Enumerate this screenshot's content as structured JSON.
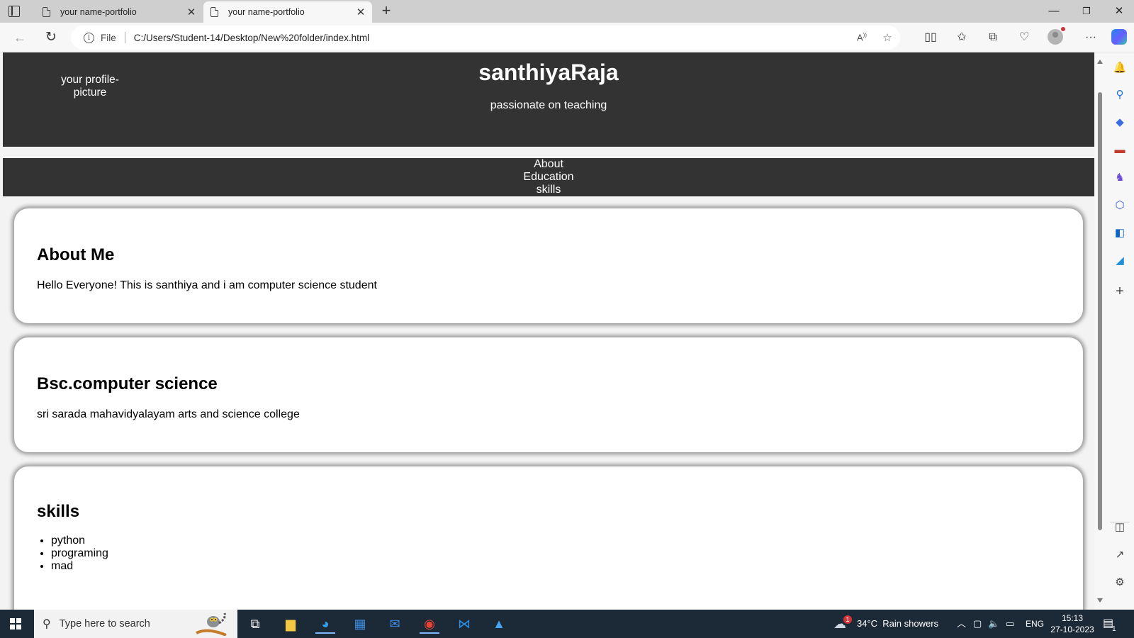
{
  "browser": {
    "tabs": [
      {
        "title": "your name-portfolio",
        "active": false
      },
      {
        "title": "your name-portfolio",
        "active": true
      }
    ],
    "new_tab_icon": "plus-icon",
    "url_scheme_label": "File",
    "url": "C:/Users/Student-14/Desktop/New%20folder/index.html"
  },
  "site": {
    "profile_picture_alt": "your profile-picture",
    "name": "santhiyaRaja",
    "tagline": "passionate on teaching",
    "nav": [
      "About",
      "Education",
      "skills"
    ],
    "about": {
      "heading": "About Me",
      "text": "Hello Everyone! This is santhiya and i am computer science student"
    },
    "education": {
      "heading": "Bsc.computer science",
      "text": "sri sarada mahavidyalayam arts and science college"
    },
    "skills": {
      "heading": "skills",
      "items": [
        "python",
        "programing",
        "mad"
      ]
    }
  },
  "taskbar": {
    "search_placeholder": "Type here to search",
    "weather": "34°C  Rain showers",
    "weather_badge": "1",
    "language": "ENG",
    "time": "15:13",
    "date": "27-10-2023",
    "notification_count": "1"
  }
}
